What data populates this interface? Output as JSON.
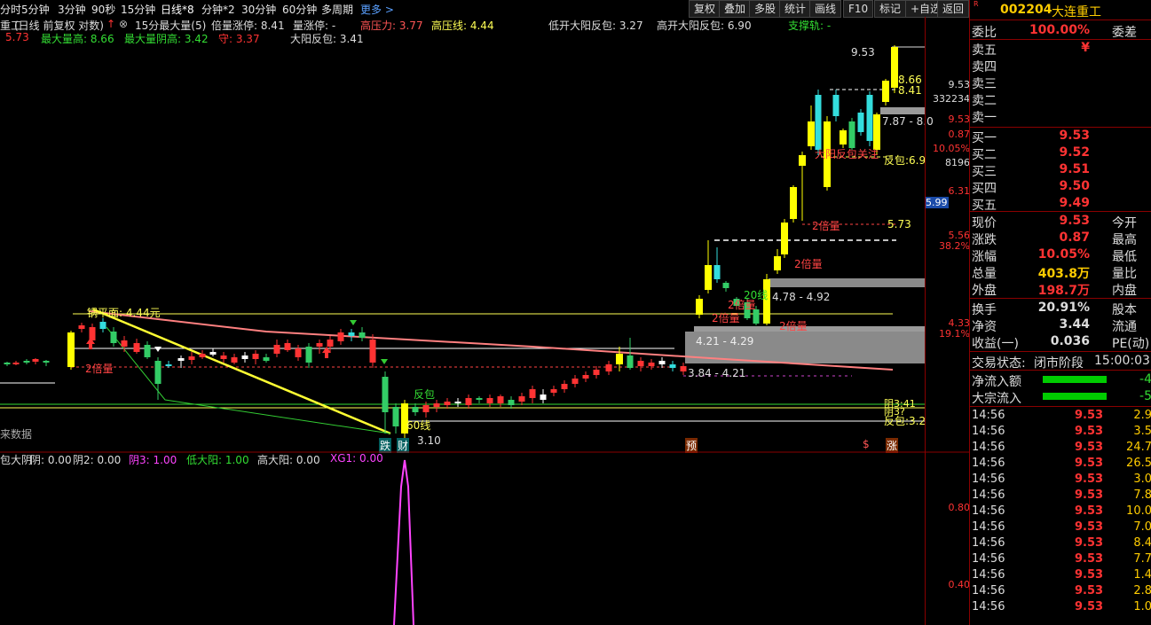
{
  "periods": [
    "分时",
    "5分钟",
    "3分钟",
    "90秒",
    "15分钟",
    "日线*8",
    "分钟*2",
    "30分钟",
    "60分钟",
    "多周期",
    "更多 >"
  ],
  "toolbar": [
    "复权",
    "叠加",
    "多股",
    "统计",
    "画线",
    "F10",
    "标记",
    "+自选",
    "返回"
  ],
  "stock": {
    "code": "002204",
    "name": "大连重工",
    "short": "重工"
  },
  "info1": {
    "title": "(日线 前复权 对数)",
    "ind": "15分最大量(5)",
    "a": "倍量涨停: 8.41",
    "b": "量涨停: -",
    "c": "高压力: 3.77",
    "d": "高压线: 4.44",
    "e": "低开大阳反包: 3.27",
    "f": "高开大阳反包: 6.90",
    "g": "支撑轨: -"
  },
  "info2": {
    "a": "5.73",
    "b": "最大量高: 8.66",
    "c": "最大量阴高: 3.42",
    "d": "守: 3.37",
    "e": "大阳反包: 3.41"
  },
  "annotations": {
    "cost": "锅平面: 4.44元",
    "x2a": "2倍量",
    "x2b": "2倍量",
    "x2c": "2倍量",
    "x2d": "2倍量",
    "x2e": "2倍量",
    "x2f": "2倍量",
    "fb1": "反包",
    "fb2": "反包:6.9",
    "fb3": "反包:3.2",
    "l20": "20线",
    "l60": "60线",
    "z1": "4.78 - 4.92",
    "z2": "4.21 - 4.29",
    "z3": "3.84 - 4.21",
    "v573": "5.73",
    "v953": "9.53",
    "v866": "8.66",
    "v841": "8.41",
    "v787": "7.87 - 8.0",
    "v310": "3.10",
    "shou": "守",
    "dayang": "大阳反包关注",
    "nodata": "来数据",
    "die": "跌",
    "cai": "财",
    "yu": "预",
    "s": "$",
    "zhang": "涨",
    "p1": "阴3:41",
    "p2": "阴3?"
  },
  "axis_main": {
    "a": "9.53",
    "b": "332234",
    "c": "9.53",
    "d": "0.87",
    "e": "10.05%",
    "f": "8196",
    "g": "6.31",
    "h": "5.99",
    "i": "5.56",
    "j": "38.2%",
    "k": "4.33",
    "l": "19.1%"
  },
  "axis_sub": {
    "a": "0.80",
    "b": "0.40"
  },
  "subinfo": {
    "a": "包大阴",
    "b": "阴: 0.00",
    "c": "阴2: 0.00",
    "d": "阴3: 1.00",
    "e": "低大阳: 1.00",
    "f": "高大阳: 0.00",
    "g": "XG1: 0.00"
  },
  "panel": {
    "weibi": "委比",
    "weibi_v": "100.00%",
    "weicha": "委差",
    "sells": [
      {
        "k": "卖五",
        "v": "¥"
      },
      {
        "k": "卖四",
        "v": ""
      },
      {
        "k": "卖三",
        "v": ""
      },
      {
        "k": "卖二",
        "v": ""
      },
      {
        "k": "卖一",
        "v": ""
      }
    ],
    "buys": [
      {
        "k": "买一",
        "v": "9.53"
      },
      {
        "k": "买二",
        "v": "9.52"
      },
      {
        "k": "买三",
        "v": "9.51"
      },
      {
        "k": "买四",
        "v": "9.50"
      },
      {
        "k": "买五",
        "v": "9.49"
      }
    ],
    "stats": [
      {
        "k": "现价",
        "v": "9.53",
        "k2": "今开",
        "c": "#ff3333"
      },
      {
        "k": "涨跌",
        "v": "0.87",
        "k2": "最高",
        "c": "#ff3333"
      },
      {
        "k": "涨幅",
        "v": "10.05%",
        "k2": "最低",
        "c": "#ff3333"
      },
      {
        "k": "总量",
        "v": "403.8万",
        "k2": "量比",
        "c": "#ffcc00"
      },
      {
        "k": "外盘",
        "v": "198.7万",
        "k2": "内盘",
        "c": "#ff3333"
      }
    ],
    "stats2": [
      {
        "k": "换手",
        "v": "20.91%",
        "k2": "股本",
        "c": "#ddd"
      },
      {
        "k": "净资",
        "v": "3.44",
        "k2": "流通",
        "c": "#ddd"
      },
      {
        "k": "收益(一)",
        "v": "0.036",
        "k2": "PE(动)",
        "c": "#ddd"
      }
    ],
    "status_k": "交易状态:",
    "status_v": "闭市阶段",
    "status_t": "15:00:03",
    "jlr": "净流入额",
    "jlr_v": "-4",
    "dzlr": "大宗流入",
    "dzlr_v": "-5",
    "ticks": [
      {
        "t": "14:56",
        "p": "9.53",
        "v": "2.9"
      },
      {
        "t": "14:56",
        "p": "9.53",
        "v": "3.5"
      },
      {
        "t": "14:56",
        "p": "9.53",
        "v": "24.7"
      },
      {
        "t": "14:56",
        "p": "9.53",
        "v": "26.5"
      },
      {
        "t": "14:56",
        "p": "9.53",
        "v": "3.0"
      },
      {
        "t": "14:56",
        "p": "9.53",
        "v": "7.8"
      },
      {
        "t": "14:56",
        "p": "9.53",
        "v": "10.0"
      },
      {
        "t": "14:56",
        "p": "9.53",
        "v": "7.0"
      },
      {
        "t": "14:56",
        "p": "9.53",
        "v": "8.4"
      },
      {
        "t": "14:56",
        "p": "9.53",
        "v": "7.7"
      },
      {
        "t": "14:56",
        "p": "9.53",
        "v": "1.4"
      },
      {
        "t": "14:56",
        "p": "9.53",
        "v": "2.8"
      },
      {
        "t": "14:56",
        "p": "9.53",
        "v": "1.0"
      }
    ]
  }
}
